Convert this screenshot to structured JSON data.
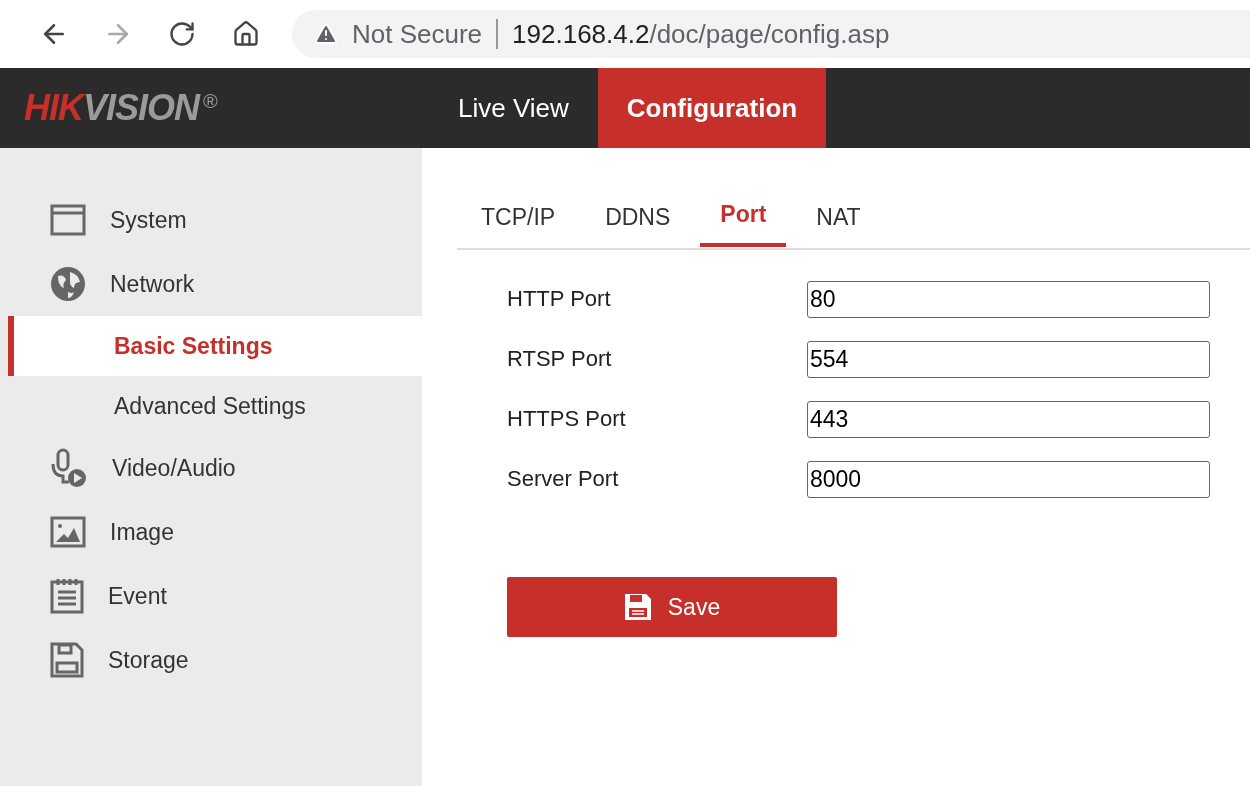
{
  "browser": {
    "security": "Not Secure",
    "url_host": "192.168.4.2",
    "url_path": "/doc/page/config.asp"
  },
  "header": {
    "logo": {
      "brand_red": "HIK",
      "brand_gray": "VISION",
      "mark": "®"
    },
    "nav": [
      {
        "label": "Live View",
        "selected": false
      },
      {
        "label": "Configuration",
        "selected": true
      }
    ]
  },
  "sidebar": {
    "items": [
      {
        "label": "System",
        "kind": "system",
        "selected": false
      },
      {
        "label": "Network",
        "kind": "network",
        "selected": false,
        "children": [
          {
            "label": "Basic Settings",
            "selected": true
          },
          {
            "label": "Advanced Settings",
            "selected": false
          }
        ]
      },
      {
        "label": "Video/Audio",
        "kind": "video",
        "selected": false
      },
      {
        "label": "Image",
        "kind": "image",
        "selected": false
      },
      {
        "label": "Event",
        "kind": "event",
        "selected": false
      },
      {
        "label": "Storage",
        "kind": "storage",
        "selected": false
      }
    ]
  },
  "tabs": [
    {
      "label": "TCP/IP",
      "selected": false
    },
    {
      "label": "DDNS",
      "selected": false
    },
    {
      "label": "Port",
      "selected": true
    },
    {
      "label": "NAT",
      "selected": false
    }
  ],
  "fields": [
    {
      "label": "HTTP Port",
      "value": "80"
    },
    {
      "label": "RTSP Port",
      "value": "554"
    },
    {
      "label": "HTTPS Port",
      "value": "443"
    },
    {
      "label": "Server Port",
      "value": "8000"
    }
  ],
  "save_button": "Save"
}
